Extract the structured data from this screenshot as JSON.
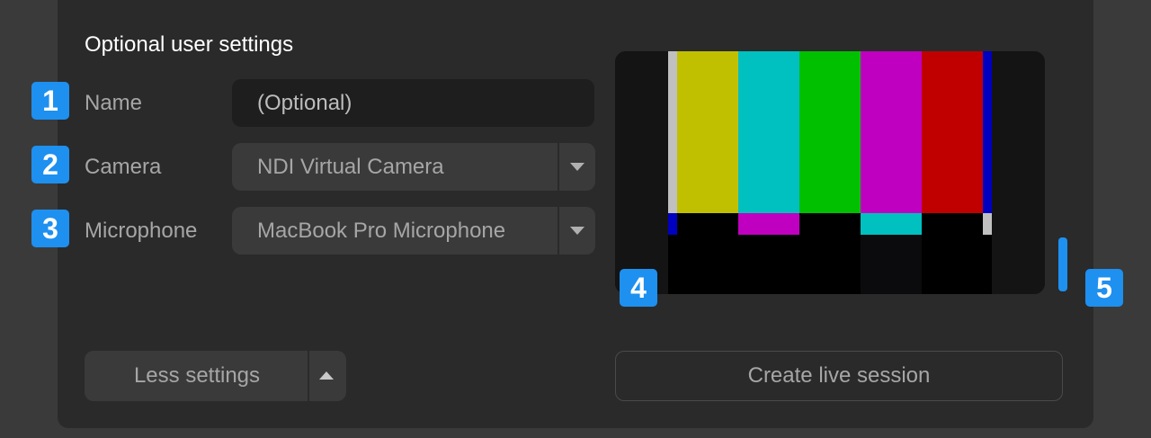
{
  "settings": {
    "title": "Optional user settings",
    "name": {
      "badge": "1",
      "label": "Name",
      "placeholder": "(Optional)"
    },
    "camera": {
      "badge": "2",
      "label": "Camera",
      "value": "NDI Virtual Camera"
    },
    "microphone": {
      "badge": "3",
      "label": "Microphone",
      "value": "MacBook Pro Microphone"
    }
  },
  "preview": {
    "badge": "4",
    "colors": {
      "gray": "#c0c0c0",
      "yellow": "#c0c000",
      "cyan": "#00c0c0",
      "green": "#00c000",
      "magenta": "#c000c0",
      "red": "#c00000",
      "blue": "#0000c0",
      "black": "#000000"
    }
  },
  "audio_meter": {
    "badge": "5",
    "accent": "#1e90f0"
  },
  "actions": {
    "less_settings": "Less settings",
    "create_session": "Create live session"
  }
}
